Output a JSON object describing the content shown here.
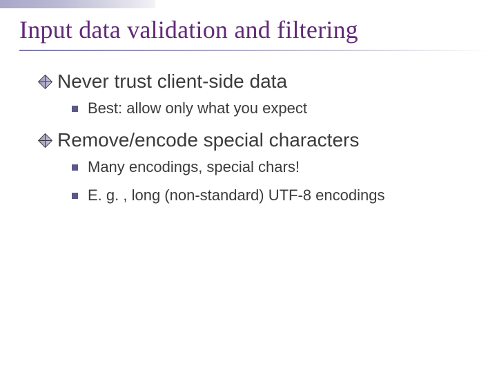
{
  "title": "Input data validation and filtering",
  "bullets": {
    "b1": {
      "text": "Never trust client-side data"
    },
    "b1_1": {
      "text": "Best: allow only what you expect"
    },
    "b2": {
      "text": "Remove/encode special characters"
    },
    "b2_1": {
      "text": "Many encodings, special chars!"
    },
    "b2_2": {
      "text": "E. g. , long (non-standard) UTF-8 encodings"
    }
  }
}
